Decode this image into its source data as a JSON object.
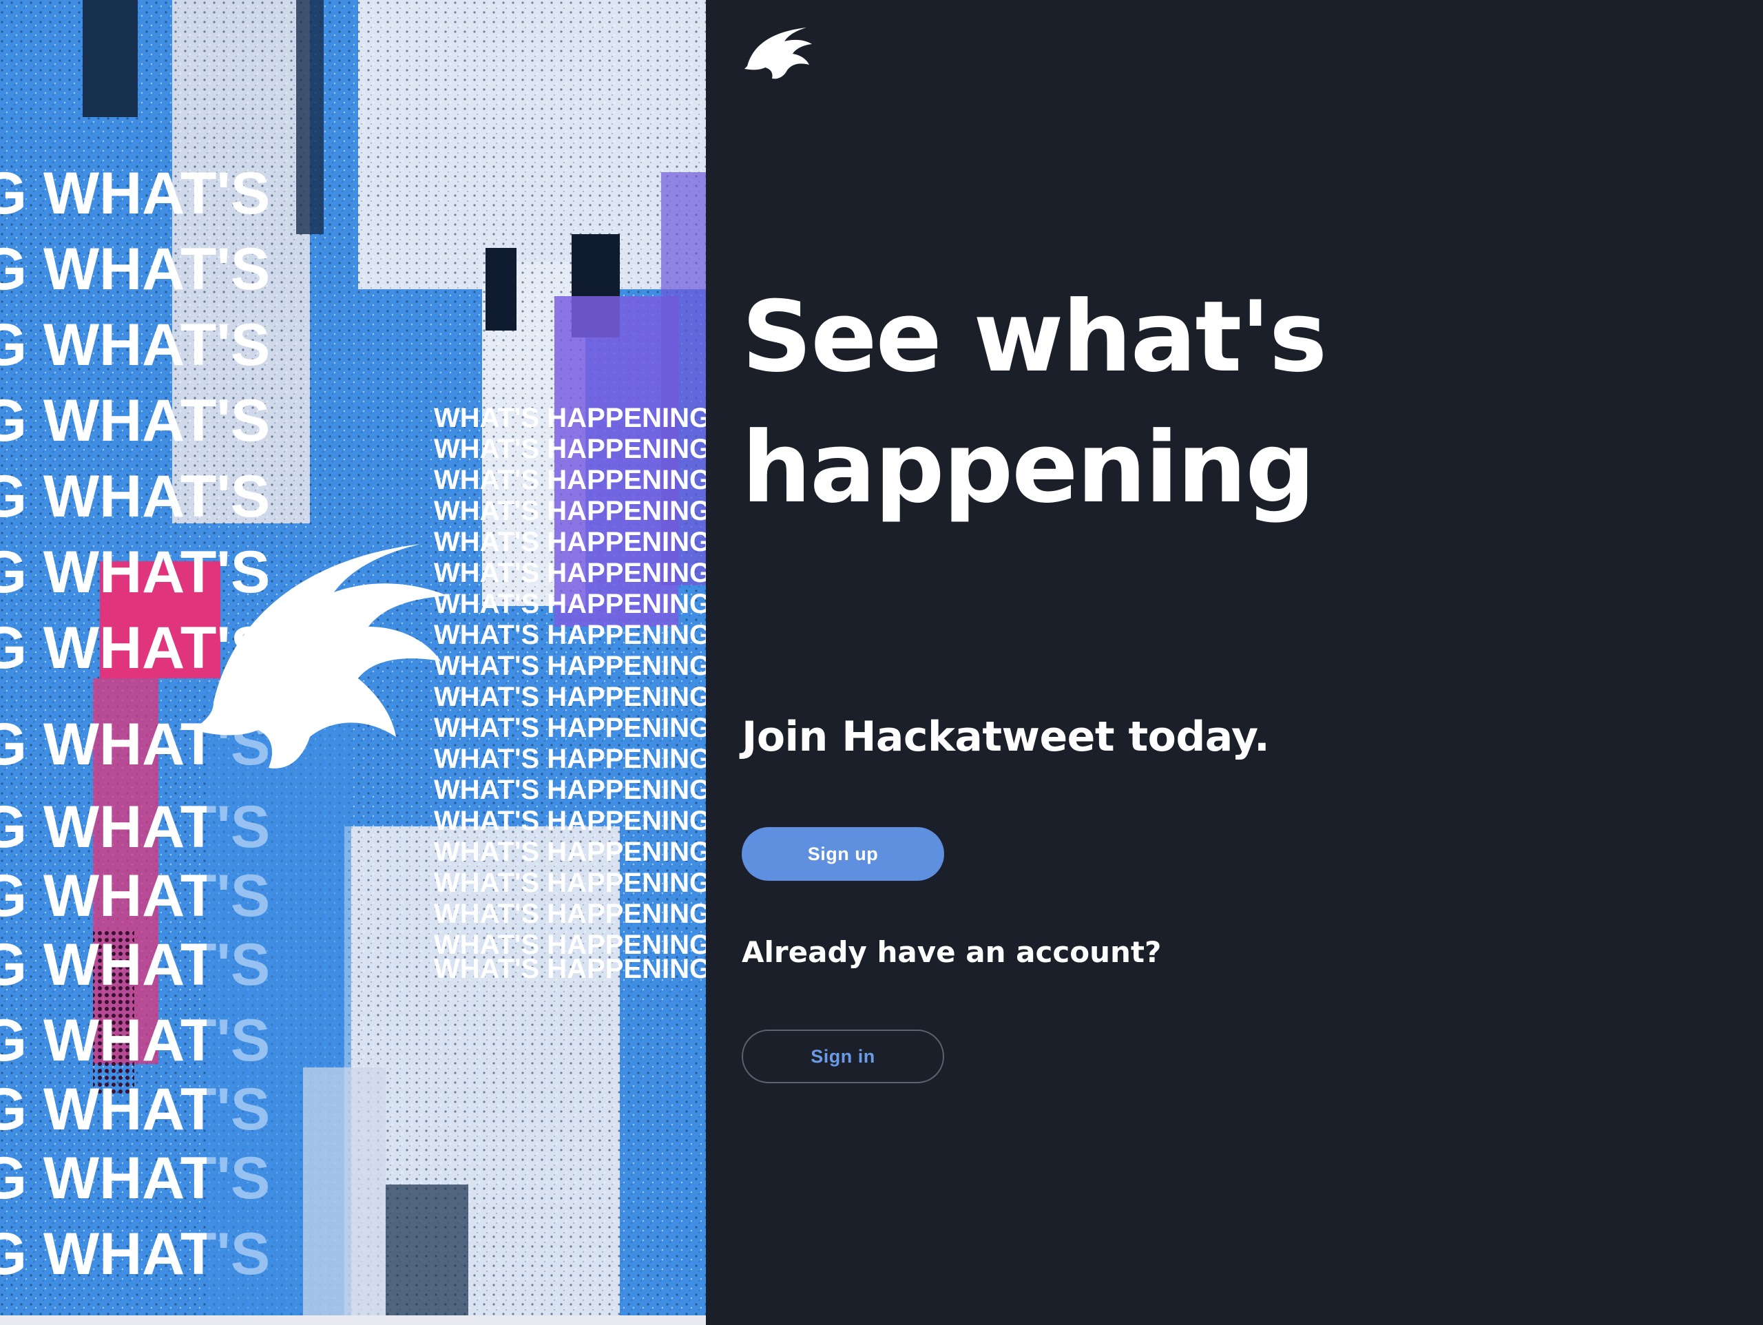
{
  "hero": {
    "image_name": "hero-collage",
    "text_tiles": [
      "WHAT'S HAPPENING"
    ],
    "palette": {
      "blue": "#3f8ee3",
      "light": "#dfe6f3",
      "pink": "#e0357c",
      "purple": "#7a5fe0",
      "navy": "#17304f"
    }
  },
  "logo": {
    "icon": "bird-logo-icon"
  },
  "headline": {
    "line1": "See what's",
    "line2": "happening"
  },
  "join_text": "Join Hackatweet today.",
  "signup_button": {
    "label": "Sign up"
  },
  "already_text": "Already have an account?",
  "signin_button": {
    "label": "Sign in"
  },
  "colors": {
    "background": "#1b1f29",
    "accent": "#5f8fdf",
    "accent_text": "#6b9ae6",
    "outline": "#5d6270",
    "text": "#ffffff"
  }
}
